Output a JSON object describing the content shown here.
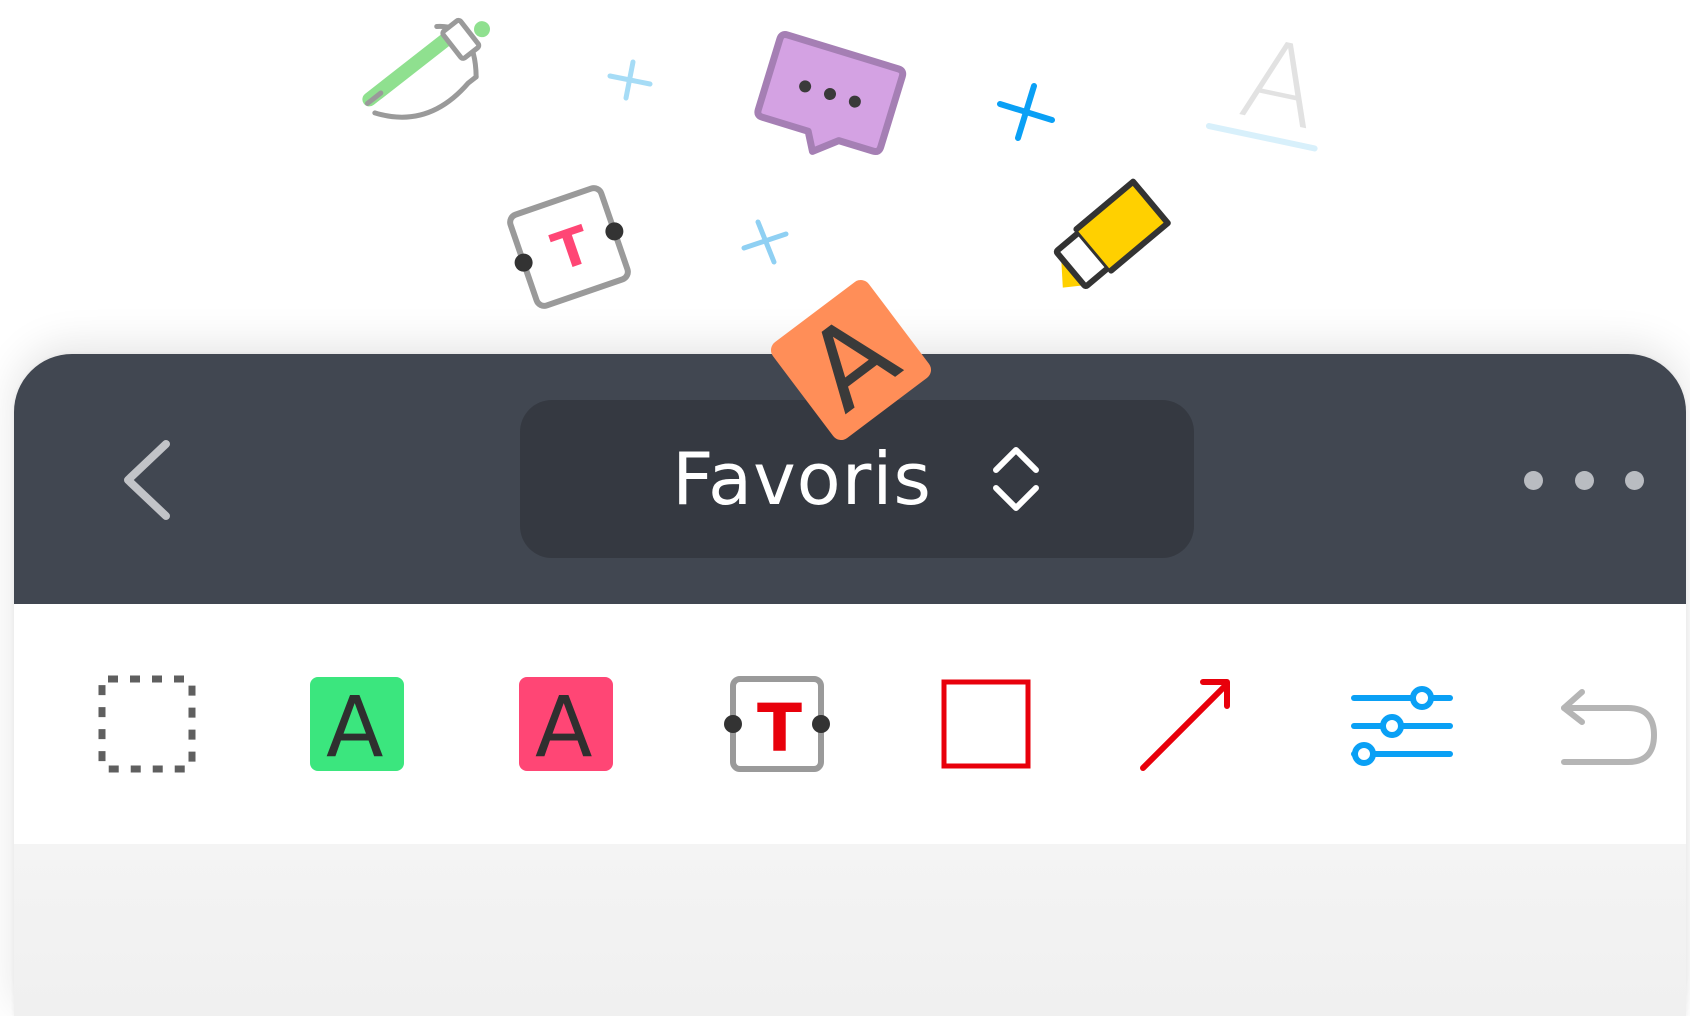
{
  "header": {
    "title": "Favoris",
    "back_icon": "chevron-left-icon",
    "switch_icon": "chevron-up-down-icon",
    "more_icon": "ellipsis-icon",
    "background_color": "#414751",
    "pill_color": "#353941"
  },
  "toolbar": {
    "tools": [
      {
        "name": "selection",
        "icon": "dashed-selection-icon"
      },
      {
        "name": "highlight-text-green",
        "icon": "green-letter-a-icon",
        "letter": "A",
        "color": "#3be67e"
      },
      {
        "name": "highlight-text-pink",
        "icon": "pink-letter-a-icon",
        "letter": "A",
        "color": "#ff4675"
      },
      {
        "name": "text-box",
        "icon": "text-box-icon",
        "letter": "T",
        "color": "#e8000b"
      },
      {
        "name": "rectangle",
        "icon": "red-square-icon",
        "color": "#e8000b"
      },
      {
        "name": "arrow",
        "icon": "red-arrow-icon",
        "color": "#e8000b"
      },
      {
        "name": "settings",
        "icon": "sliders-icon",
        "color": "#0aa0f5"
      },
      {
        "name": "undo",
        "icon": "undo-icon",
        "color": "#b5b5b5"
      }
    ]
  },
  "floating_icons": {
    "items": [
      "green-marker-icon",
      "speech-bubble-icon",
      "faded-letter-a-icon",
      "text-box-icon",
      "yellow-highlighter-icon",
      "orange-letter-a-icon",
      "sparkle-icon"
    ],
    "orange_letter": "A",
    "faded_letter": "A",
    "text_box_letter": "T"
  }
}
